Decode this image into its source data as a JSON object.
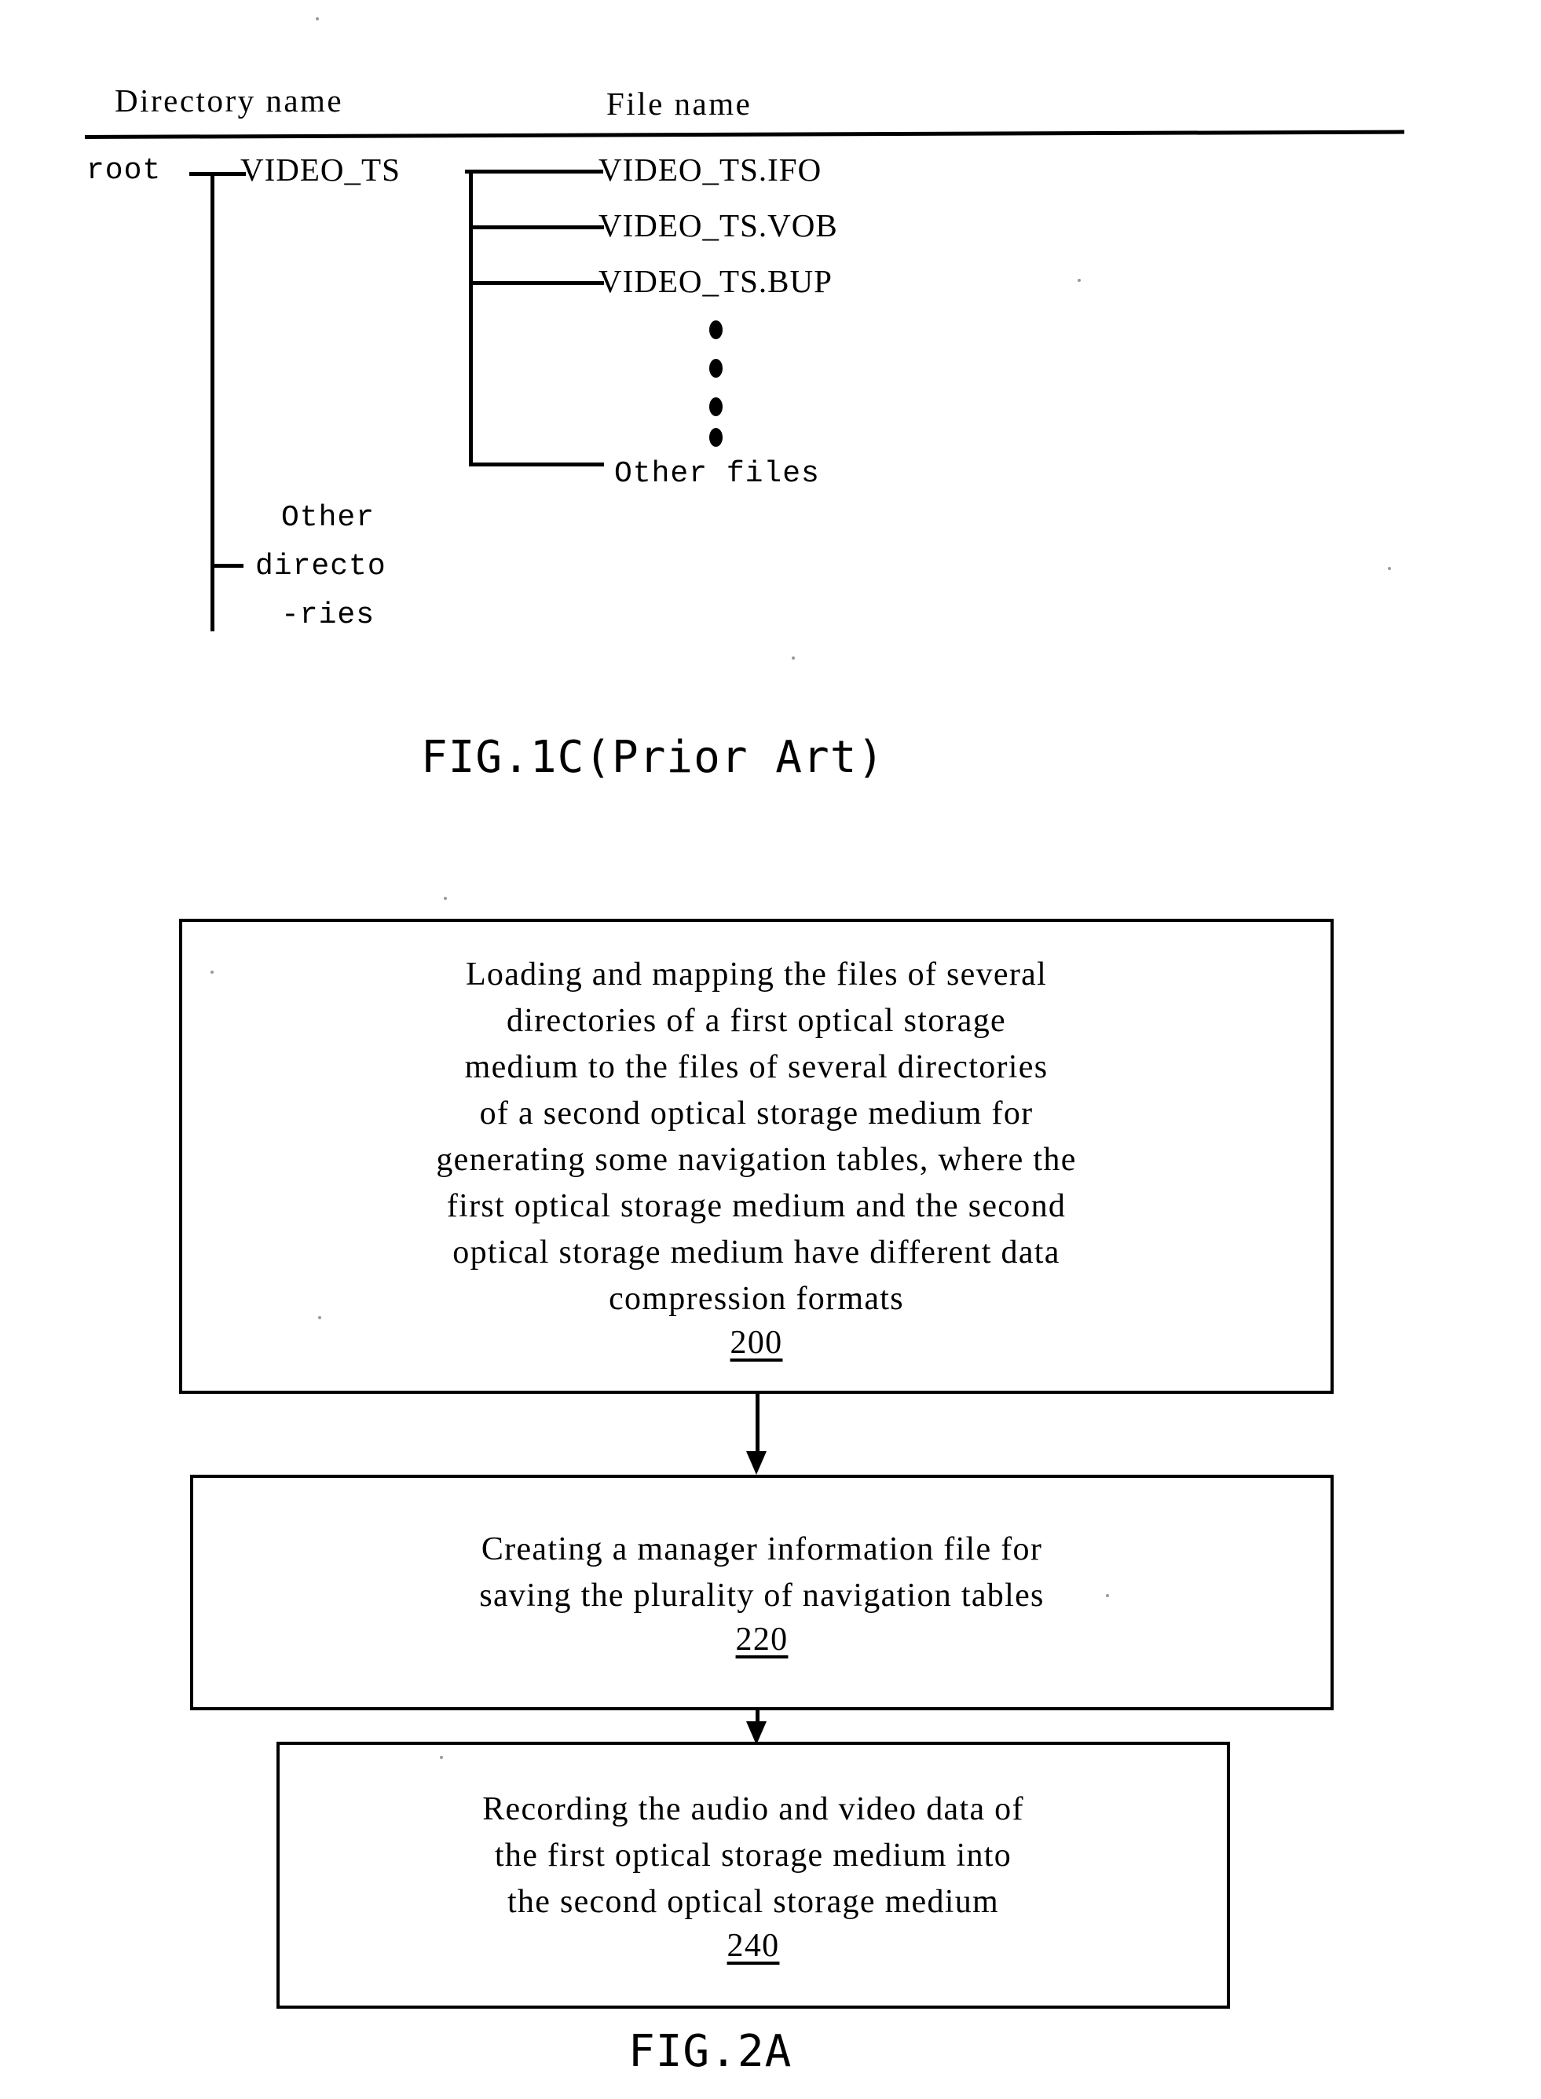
{
  "figures": [
    {
      "id": "fig-1c",
      "caption": "FIG.1C(Prior Art)",
      "columns": {
        "directory_name": "Directory name",
        "file_name": "File name"
      },
      "tree": {
        "root": "root",
        "directory": "VIDEO_TS",
        "files": [
          "VIDEO_TS.IFO",
          "VIDEO_TS.VOB",
          "VIDEO_TS.BUP"
        ],
        "ellipsis": "⋮",
        "other_files": "Other files",
        "other_directories_lines": [
          "Other",
          "directo",
          "-ries"
        ]
      }
    },
    {
      "id": "fig-2a",
      "caption": "FIG.2A",
      "steps": [
        {
          "text": "Loading and mapping the files of several\ndirectories of a first optical storage\nmedium to the files of several directories\nof a second optical storage medium for\ngenerating some navigation tables, where the\nfirst optical storage medium and the second\noptical storage medium have different data\ncompression formats",
          "number": "200"
        },
        {
          "text": "Creating a manager information file for\nsaving the plurality of navigation tables",
          "number": "220"
        },
        {
          "text": "Recording the audio and video data of\nthe first optical storage medium into\nthe second optical storage medium",
          "number": "240"
        }
      ]
    }
  ],
  "colors": {
    "ink": "#000000",
    "paper": "#ffffff"
  }
}
